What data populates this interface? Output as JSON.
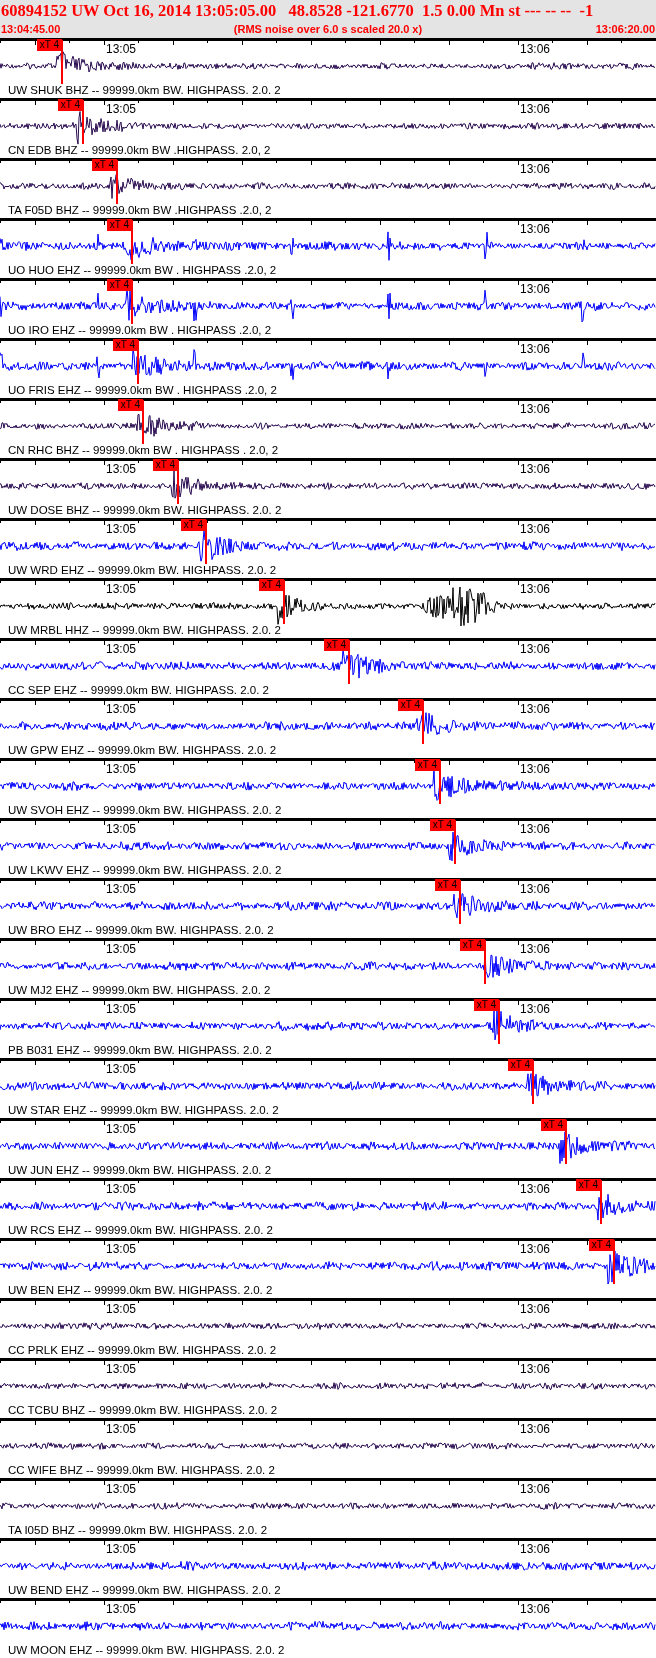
{
  "header": {
    "title": "60894152 UW Oct 16, 2014 13:05:05.00   48.8528 -121.6770  1.5 0.00 Mn st --- -- --  -1",
    "start_time": "13:04:45.00",
    "note": "(RMS noise over 6.0 s scaled 20.0 x)",
    "end_time": "13:06:20.00"
  },
  "traces": [
    {
      "label": "UW SHUK BHZ -- 99999.0km BW. HIGHPASS. 2.0. 2",
      "color": "#280a50",
      "first_minute": "13:05",
      "second_minute": "13:06",
      "pick": "xT 4"
    },
    {
      "label": "CN EDB BHZ -- 99999.0km BW .HIGHPASS. 2.0, 2",
      "color": "#280a50",
      "first_minute": "13:05",
      "second_minute": "13:06",
      "pick": "xT 4"
    },
    {
      "label": "TA F05D BHZ -- 99999.0km BW .HIGHPASS .2.0, 2",
      "color": "#280a50",
      "second_minute": "13:06",
      "pick": "xT 4"
    },
    {
      "label": "UO HUO EHZ -- 99999.0km BW . HIGHPASS .2.0, 2",
      "color": "#0000ff",
      "second_minute": "13:06",
      "pick": "xT 4"
    },
    {
      "label": "UO IRO EHZ -- 99999.0km BW . HIGHPASS .2.0, 2",
      "color": "#0000ff",
      "second_minute": "13:06",
      "pick": "xT 4"
    },
    {
      "label": "UO FRIS EHZ -- 99999.0km BW . HIGHPASS .2.0, 2",
      "color": "#0000ff",
      "second_minute": "13:06",
      "pick": "xT 4"
    },
    {
      "label": "CN RHC BHZ -- 99999.0km BW . HIGHPASS . 2.0, 2",
      "color": "#280a50",
      "second_minute": "13:06",
      "pick": "xT 4"
    },
    {
      "label": "UW DOSE BHZ -- 99999.0km BW. HIGHPASS. 2.0. 2",
      "color": "#280a50",
      "first_minute": "13:05",
      "second_minute": "13:06",
      "pick": "xT 4"
    },
    {
      "label": "UW WRD EHZ -- 99999.0km BW. HIGHPASS. 2.0. 2",
      "color": "#0000ff",
      "first_minute": "13:05",
      "second_minute": "13:06",
      "pick": "xT 4"
    },
    {
      "label": "UW MRBL HHZ -- 99999.0km BW. HIGHPASS. 2.0. 2",
      "color": "#000000",
      "first_minute": "13:05",
      "second_minute": "13:06",
      "pick": "xT 4"
    },
    {
      "label": "CC SEP EHZ -- 99999.0km BW. HIGHPASS. 2.0. 2",
      "color": "#0000ff",
      "first_minute": "13:05",
      "second_minute": "13:06",
      "pick": "xT 4"
    },
    {
      "label": "UW GPW EHZ -- 99999.0km BW. HIGHPASS. 2.0. 2",
      "color": "#0000ff",
      "first_minute": "13:05",
      "second_minute": "13:06",
      "pick": "xT 4"
    },
    {
      "label": "UW SVOH EHZ -- 99999.0km BW. HIGHPASS. 2.0. 2",
      "color": "#0000ff",
      "first_minute": "13:05",
      "second_minute": "13:06",
      "pick": "xT 4"
    },
    {
      "label": "UW LKWV EHZ -- 99999.0km BW. HIGHPASS. 2.0. 2",
      "color": "#0000ff",
      "first_minute": "13:05",
      "second_minute": "13:06",
      "pick": "xT 4"
    },
    {
      "label": "UW BRO EHZ -- 99999.0km BW. HIGHPASS. 2.0. 2",
      "color": "#0000ff",
      "first_minute": "13:05",
      "second_minute": "13:06",
      "pick": "xT 4"
    },
    {
      "label": "UW MJ2 EHZ -- 99999.0km BW. HIGHPASS. 2.0. 2",
      "color": "#0000ff",
      "first_minute": "13:05",
      "second_minute": "13:06",
      "pick": "xT 4"
    },
    {
      "label": "PB B031 EHZ -- 99999.0km BW. HIGHPASS. 2.0. 2",
      "color": "#0000ff",
      "first_minute": "13:05",
      "second_minute": "13:06",
      "pick": "xT 4"
    },
    {
      "label": "UW STAR EHZ -- 99999.0km BW. HIGHPASS. 2.0. 2",
      "color": "#0000ff",
      "first_minute": "13:05",
      "pick": "xT 4"
    },
    {
      "label": "UW JUN EHZ -- 99999.0km BW. HIGHPASS. 2.0. 2",
      "color": "#0000ff",
      "first_minute": "13:05",
      "pick": "xT 4"
    },
    {
      "label": "UW RCS EHZ -- 99999.0km BW. HIGHPASS. 2.0. 2",
      "color": "#0000ff",
      "first_minute": "13:05",
      "second_minute": "13:06",
      "pick": "xT 4"
    },
    {
      "label": "UW BEN EHZ -- 99999.0km BW. HIGHPASS. 2.0. 2",
      "color": "#0000ff",
      "first_minute": "13:05",
      "second_minute": "13:06",
      "pick": "xT 4"
    },
    {
      "label": "CC PRLK EHZ -- 99999.0km BW. HIGHPASS. 2.0. 2",
      "color": "#280a50",
      "first_minute": "13:05",
      "second_minute": "13:06"
    },
    {
      "label": "CC TCBU BHZ -- 99999.0km BW. HIGHPASS. 2.0. 2",
      "color": "#280a50",
      "first_minute": "13:05",
      "second_minute": "13:06"
    },
    {
      "label": "CC WIFE BHZ -- 99999.0km BW. HIGHPASS. 2.0. 2",
      "color": "#280a50",
      "first_minute": "13:05",
      "second_minute": "13:06"
    },
    {
      "label": "TA I05D BHZ -- 99999.0km BW. HIGHPASS. 2.0. 2",
      "color": "#280a50",
      "first_minute": "13:05",
      "second_minute": "13:06"
    },
    {
      "label": "UW BEND EHZ -- 99999.0km BW. HIGHPASS. 2.0. 2",
      "color": "#0000ff",
      "first_minute": "13:05",
      "second_minute": "13:06"
    },
    {
      "label": "UW MOON EHZ -- 99999.0km BW. HIGHPASS. 2.0. 2",
      "color": "#0000ff",
      "first_minute": "13:05",
      "second_minute": "13:06"
    }
  ]
}
